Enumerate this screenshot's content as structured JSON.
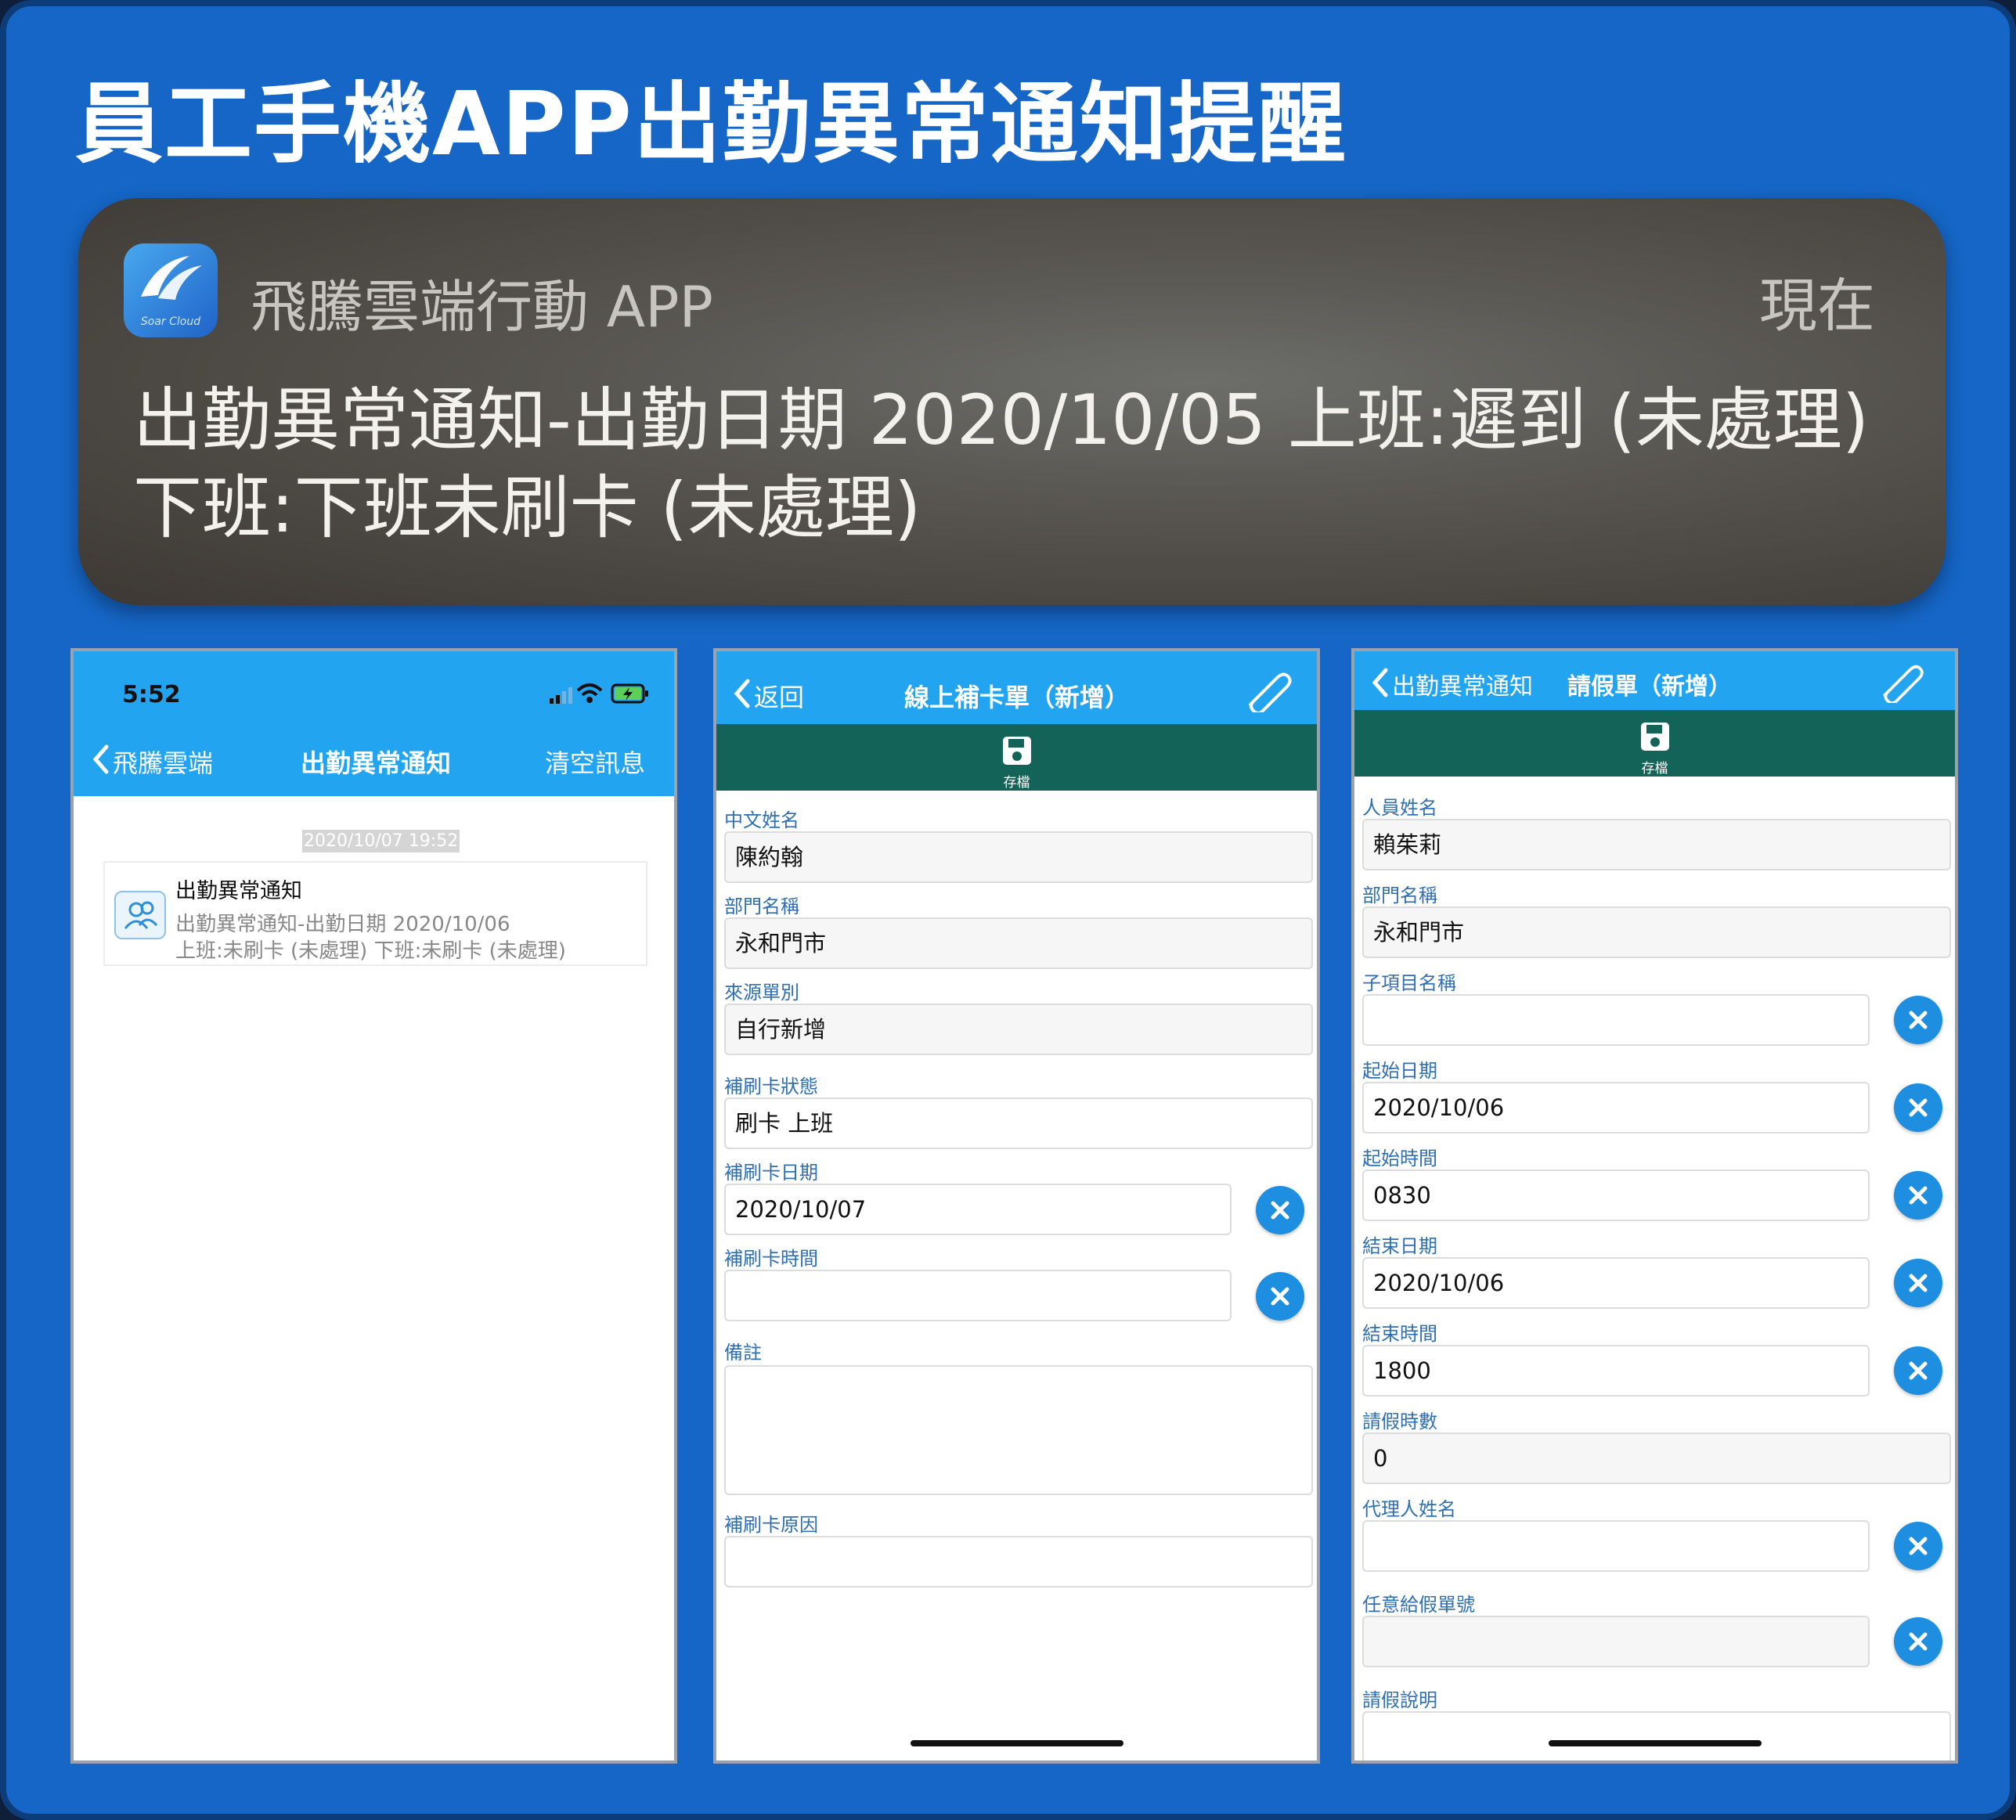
{
  "page_title": "員工手機APP出勤異常通知提醒",
  "notification": {
    "app_icon_caption": "Soar Cloud",
    "app_name": "飛騰雲端行動 APP",
    "time": "現在",
    "body_line1": "出勤異常通知-出勤日期 2020/10/05 上班:遲到 (未處理)",
    "body_line2": "下班:下班未刷卡 (未處理)"
  },
  "phone1": {
    "status_time": "5:52",
    "back_label": "飛騰雲端",
    "title": "出勤異常通知",
    "right_action": "清空訊息",
    "timestamp": "2020/10/07 19:52",
    "message": {
      "title": "出勤異常通知",
      "line1": "出勤異常通知-出勤日期 2020/10/06",
      "line2": "上班:未刷卡 (未處理) 下班:未刷卡 (未處理)"
    }
  },
  "phone2": {
    "back_label": "返回",
    "title": "線上補卡單（新增）",
    "save_label": "存檔",
    "fields": {
      "name_label": "中文姓名",
      "name_value": "陳約翰",
      "dept_label": "部門名稱",
      "dept_value": "永和門市",
      "source_label": "來源單別",
      "source_value": "自行新增",
      "status_label": "補刷卡狀態",
      "status_value": "刷卡 上班",
      "date_label": "補刷卡日期",
      "date_value": "2020/10/07",
      "time_label": "補刷卡時間",
      "time_value": "",
      "note_label": "備註",
      "note_value": "",
      "reason_label": "補刷卡原因",
      "reason_value": ""
    }
  },
  "phone3": {
    "back_label": "出勤異常通知",
    "title": "請假單（新增）",
    "save_label": "存檔",
    "fields": {
      "name_label": "人員姓名",
      "name_value": "賴茱莉",
      "dept_label": "部門名稱",
      "dept_value": "永和門市",
      "sub_label": "子項目名稱",
      "sub_value": "",
      "start_date_label": "起始日期",
      "start_date_value": "2020/10/06",
      "start_time_label": "起始時間",
      "start_time_value": "0830",
      "end_date_label": "結束日期",
      "end_date_value": "2020/10/06",
      "end_time_label": "結束時間",
      "end_time_value": "1800",
      "hours_label": "請假時數",
      "hours_value": "0",
      "agent_label": "代理人姓名",
      "agent_value": "",
      "leave_no_label": "任意給假單號",
      "leave_no_value": "",
      "desc_label": "請假說明",
      "desc_value": ""
    }
  },
  "colors": {
    "background": "#1566c7",
    "header_blue": "#22a4f0",
    "toolbar_green": "#146358",
    "label_blue": "#2f6fb2",
    "clear_button": "#1e8ee0"
  },
  "icons": {
    "app": "soar-cloud-logo-icon",
    "back": "chevron-left-icon",
    "attach": "paperclip-icon",
    "save": "floppy-disk-icon",
    "clear": "clear-x-icon",
    "message": "people-calendar-icon",
    "signal": "cellular-signal-icon",
    "wifi": "wifi-icon",
    "battery": "battery-charging-icon"
  }
}
